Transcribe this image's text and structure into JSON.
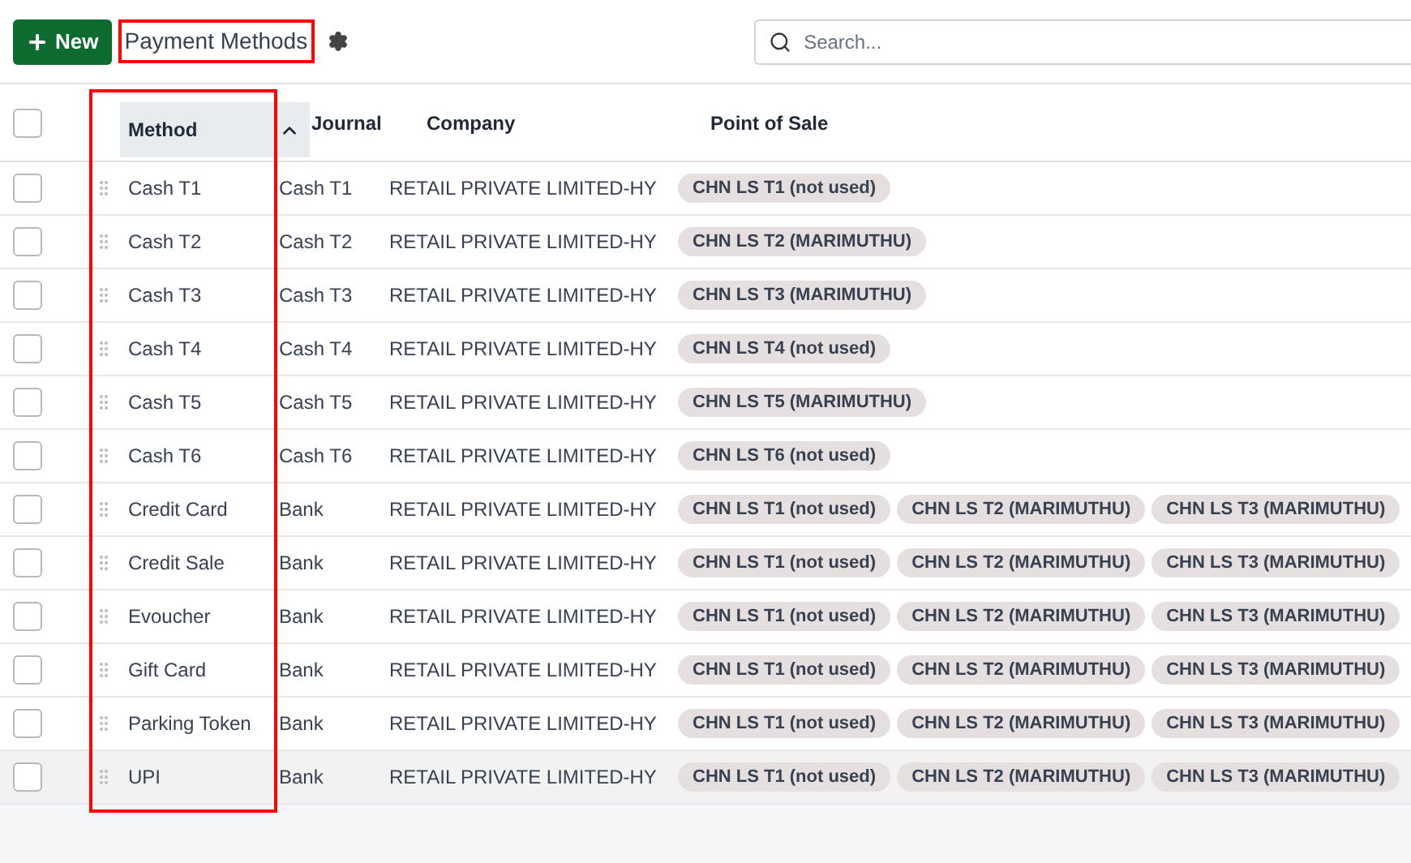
{
  "toolbar": {
    "new_button": "New",
    "title": "Payment Methods",
    "title_highlighted": true,
    "search": {
      "placeholder": "Search..."
    }
  },
  "table": {
    "select_all_checked": false,
    "method_column_highlighted": true,
    "columns": [
      {
        "label": "Method",
        "sorted": true
      },
      {
        "label": "Journal",
        "sorted": false
      },
      {
        "label": "Company",
        "sorted": false
      },
      {
        "label": "Point of Sale",
        "sorted": false
      }
    ],
    "rows": [
      {
        "method": "Cash T1",
        "journal": "Cash T1",
        "company": "RETAIL PRIVATE LIMITED-HY",
        "pos": [
          "CHN LS T1 (not used)"
        ],
        "checked": false,
        "hovered": false
      },
      {
        "method": "Cash T2",
        "journal": "Cash T2",
        "company": "RETAIL PRIVATE LIMITED-HY",
        "pos": [
          "CHN LS T2 (MARIMUTHU)"
        ],
        "checked": false,
        "hovered": false
      },
      {
        "method": "Cash T3",
        "journal": "Cash T3",
        "company": "RETAIL PRIVATE LIMITED-HY",
        "pos": [
          "CHN LS T3 (MARIMUTHU)"
        ],
        "checked": false,
        "hovered": false
      },
      {
        "method": "Cash T4",
        "journal": "Cash T4",
        "company": "RETAIL PRIVATE LIMITED-HY",
        "pos": [
          "CHN LS T4 (not used)"
        ],
        "checked": false,
        "hovered": false
      },
      {
        "method": "Cash T5",
        "journal": "Cash T5",
        "company": "RETAIL PRIVATE LIMITED-HY",
        "pos": [
          "CHN LS T5 (MARIMUTHU)"
        ],
        "checked": false,
        "hovered": false
      },
      {
        "method": "Cash T6",
        "journal": "Cash T6",
        "company": "RETAIL PRIVATE LIMITED-HY",
        "pos": [
          "CHN LS T6 (not used)"
        ],
        "checked": false,
        "hovered": false
      },
      {
        "method": "Credit Card",
        "journal": "Bank",
        "company": "RETAIL PRIVATE LIMITED-HY",
        "pos": [
          "CHN LS T1 (not used)",
          "CHN LS T2 (MARIMUTHU)",
          "CHN LS T3 (MARIMUTHU)"
        ],
        "checked": false,
        "hovered": false
      },
      {
        "method": "Credit Sale",
        "journal": "Bank",
        "company": "RETAIL PRIVATE LIMITED-HY",
        "pos": [
          "CHN LS T1 (not used)",
          "CHN LS T2 (MARIMUTHU)",
          "CHN LS T3 (MARIMUTHU)"
        ],
        "checked": false,
        "hovered": false
      },
      {
        "method": "Evoucher",
        "journal": "Bank",
        "company": "RETAIL PRIVATE LIMITED-HY",
        "pos": [
          "CHN LS T1 (not used)",
          "CHN LS T2 (MARIMUTHU)",
          "CHN LS T3 (MARIMUTHU)"
        ],
        "checked": false,
        "hovered": false
      },
      {
        "method": "Gift Card",
        "journal": "Bank",
        "company": "RETAIL PRIVATE LIMITED-HY",
        "pos": [
          "CHN LS T1 (not used)",
          "CHN LS T2 (MARIMUTHU)",
          "CHN LS T3 (MARIMUTHU)"
        ],
        "checked": false,
        "hovered": false
      },
      {
        "method": "Parking Token",
        "journal": "Bank",
        "company": "RETAIL PRIVATE LIMITED-HY",
        "pos": [
          "CHN LS T1 (not used)",
          "CHN LS T2 (MARIMUTHU)",
          "CHN LS T3 (MARIMUTHU)"
        ],
        "checked": false,
        "hovered": false
      },
      {
        "method": "UPI",
        "journal": "Bank",
        "company": "RETAIL PRIVATE LIMITED-HY",
        "pos": [
          "CHN LS T1 (not used)",
          "CHN LS T2 (MARIMUTHU)",
          "CHN LS T3 (MARIMUTHU)"
        ],
        "checked": false,
        "hovered": true
      }
    ]
  }
}
